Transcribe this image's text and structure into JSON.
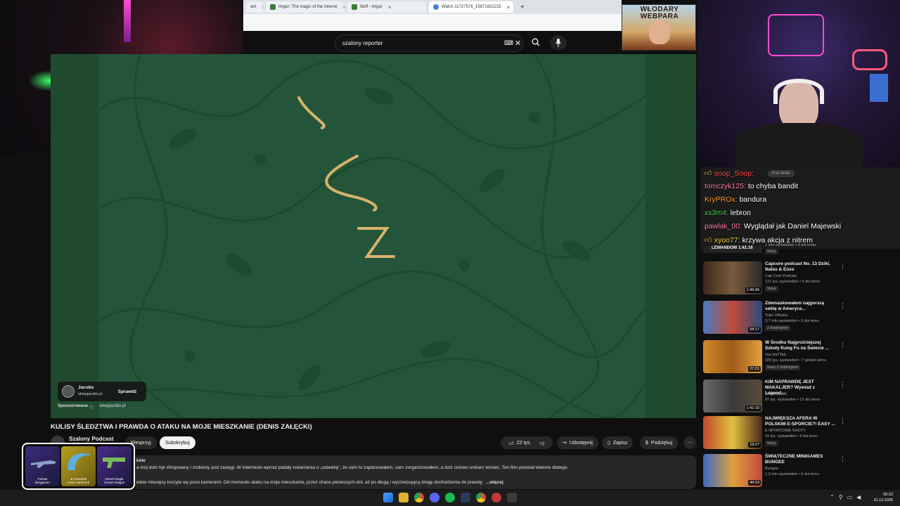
{
  "browser": {
    "tabs": [
      {
        "label": "am"
      },
      {
        "label": "Imgur: The magic of the Interne"
      },
      {
        "label": "fdcff - Imgur"
      },
      {
        "label": "Watch 11727576_15871932215"
      }
    ],
    "new_tab": "+"
  },
  "banner": {
    "text": "WŁODARY WEBPARA"
  },
  "search": {
    "query": "szalony reporter"
  },
  "ad": {
    "name": "Jacobs",
    "domain": "sklepjacobs.pl",
    "cta": "Sprawdź",
    "sponsored": "Sponsorowane",
    "sponsor_domain": "sklepjacobs.pl"
  },
  "video": {
    "title": "KULISY ŚLEDZTWA I PRAWDA O ATAKU NA MOJE MIESZKANIE (DENIS ZAŁĘCKI)",
    "channel": "Szalony Podcast",
    "support": "Wesprzyj",
    "subscribe": "Subskrybuj",
    "likes": "22 tys.",
    "share": "Udostępnij",
    "save": "Zapisz",
    "thanks": "Podziękuj",
    "desc_partial": "ków",
    "desc_line1": "a mój dom był sfingowany i zrobiony pod zasięgi. W internecie wprost padały oskarżenia o „ustawkę”, że sam to zaplanowałem, sam zorganizowałem, a dziś celowo unikam tematu. Ten film powstał właśnie dlatego.",
    "desc_line2": "wiele miesięcy toczyła się poza kamerami. Od momentu ataku na moje mieszkanie, przez chaos pierwszych dni, aż po długą i wyczerpującą drogę dochodzenia do prawdy",
    "more": "...więcej"
  },
  "skins": [
    {
      "label": "Famas\nBergamon"
    },
    {
      "label": "★ Karambit\nCase Hardened"
    },
    {
      "label": "Desert Eagle\nOcean Dragon"
    }
  ],
  "chat": [
    {
      "user": "snop_Soop:",
      "text": "",
      "color": "#ff4b4b"
    },
    {
      "user": "tomczyk125:",
      "text": "to chyba bandit",
      "color": "#ff7aa0"
    },
    {
      "user": "KryPROx:",
      "text": "bandura",
      "color": "#ff9a2e"
    },
    {
      "user": "xs3m4:",
      "text": "lebron",
      "color": "#3fd43f"
    },
    {
      "user": "pawlak_00:",
      "text": "Wyglądał jak Daniel Majewski",
      "color": "#ff7aa0"
    },
    {
      "user": "xyoo77:",
      "text": "krzywa akcja z nitrem",
      "color": "#ffcc33"
    }
  ],
  "chat_buy": "Kup teraz",
  "recommendations": [
    {
      "title": "LEWANDOW",
      "duration": "1:41:16",
      "meta1": "Prawdziwy Lewandowski",
      "meta2": "1 mln wyświetleń • 4 dni temu",
      "badge": "Nowy"
    },
    {
      "title": "Capcore podcast No. 13 Dziki, Nafas & Enzo",
      "duration": "1:49:49",
      "meta1": "Cap Core Podcast",
      "meta2": "121 tys. wyświetleń • 5 dni temu",
      "badge": "Nowy"
    },
    {
      "title": "Zdemaskowałem najgorszą sektę w Ameryce...",
      "duration": "58:17",
      "meta1": "Tyler Oliveira",
      "meta2": "3,7 mln wyświetleń • 9 dni temu",
      "badge": "Z dubbingiem"
    },
    {
      "title": "W Środku Najgroźniejszej Szkoły Kung Fu na Świecie ...",
      "duration": "27:21",
      "meta1": "Joe HaTTab",
      "meta2": "325 tys. wyświetleń • 7 godzin temu",
      "badge": "Nowy   Z dubbingiem"
    },
    {
      "title": "KIM NAPRAWDĘ JEST MAKALJER? Wywiad z Legend...",
      "duration": "1:41:10",
      "meta1": "DOMINEWS",
      "meta2": "87 tys. wyświetleń • 12 dni temu",
      "badge": ""
    },
    {
      "title": "NAJWIĘKSZA AFERA W POLSKIM E-SPORCIE?! EASY ...",
      "duration": "19:27",
      "meta1": "E-SPORTOWE SHOTY",
      "meta2": "15 tys. wyświetleń • 4 dni temu",
      "badge": "Nowy"
    },
    {
      "title": "ŚWIĄTECZNE MINIGAMES BUNGEE",
      "duration": "44:10",
      "meta1": "Bungee",
      "meta2": "1,3 mln wyświetleń • 6 dni temu",
      "badge": ""
    }
  ],
  "clock": {
    "time": "00:22",
    "date": "31.12.2025"
  },
  "colors": {
    "accent_green": "#24553a",
    "yt_bg": "#0f0f0f"
  }
}
